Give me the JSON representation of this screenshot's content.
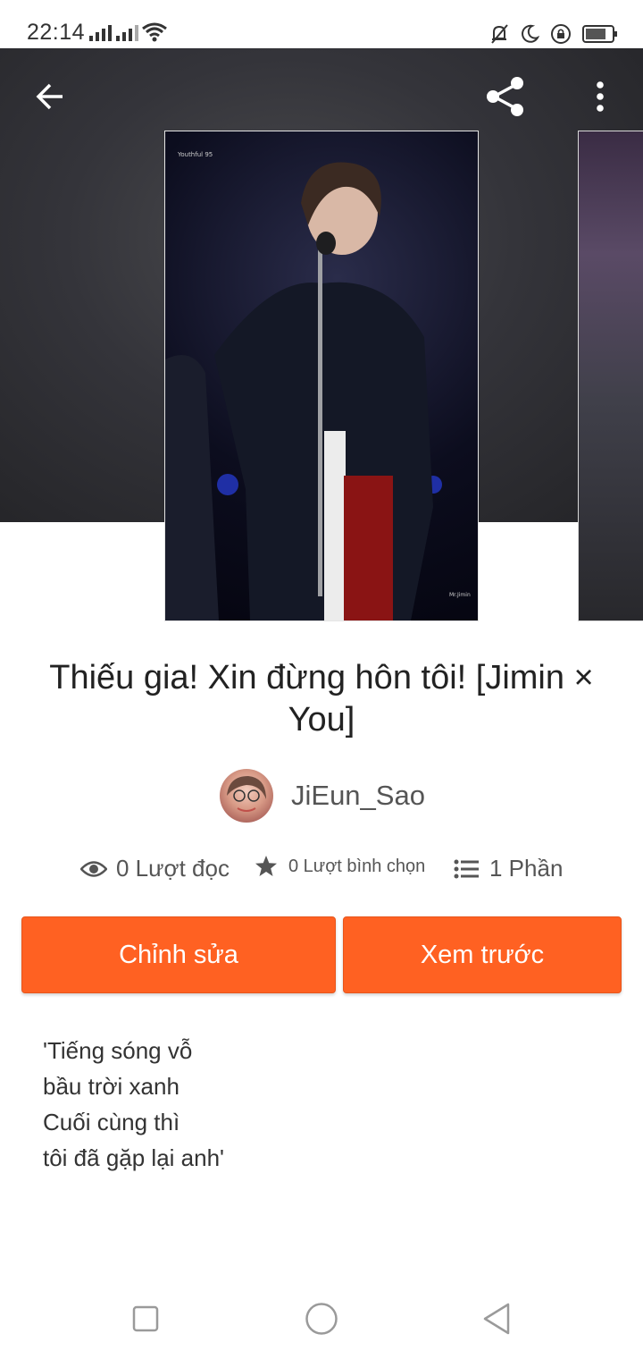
{
  "status_bar": {
    "time": "22:14",
    "icons": [
      "signal-icon",
      "signal-icon",
      "wifi-icon",
      "muted-bell-icon",
      "moon-icon",
      "lock-rotation-icon",
      "battery-icon"
    ]
  },
  "toolbar": {
    "back_icon": "arrow-left-icon",
    "share_icon": "share-icon",
    "more_icon": "more-vertical-icon"
  },
  "story": {
    "title": "Thiếu gia! Xin đừng hôn tôi! [Jimin × You]",
    "author": "JiEun_Sao",
    "stats": {
      "reads": "0 Lượt đọc",
      "votes": "0 Lượt bình chọn",
      "parts": "1 Phần"
    },
    "description_lines": [
      "'Tiếng sóng vỗ",
      "bầu trời xanh",
      "Cuối cùng thì",
      "tôi đã gặp lại anh'"
    ]
  },
  "actions": {
    "edit_label": "Chỉnh sửa",
    "preview_label": "Xem trước"
  },
  "nav_bar": {
    "icons": [
      "recents-square-icon",
      "home-circle-icon",
      "back-triangle-icon"
    ]
  },
  "colors": {
    "accent": "#ff6122",
    "hero_bg": "#34343a",
    "text_primary": "#222222",
    "text_secondary": "#555555"
  }
}
